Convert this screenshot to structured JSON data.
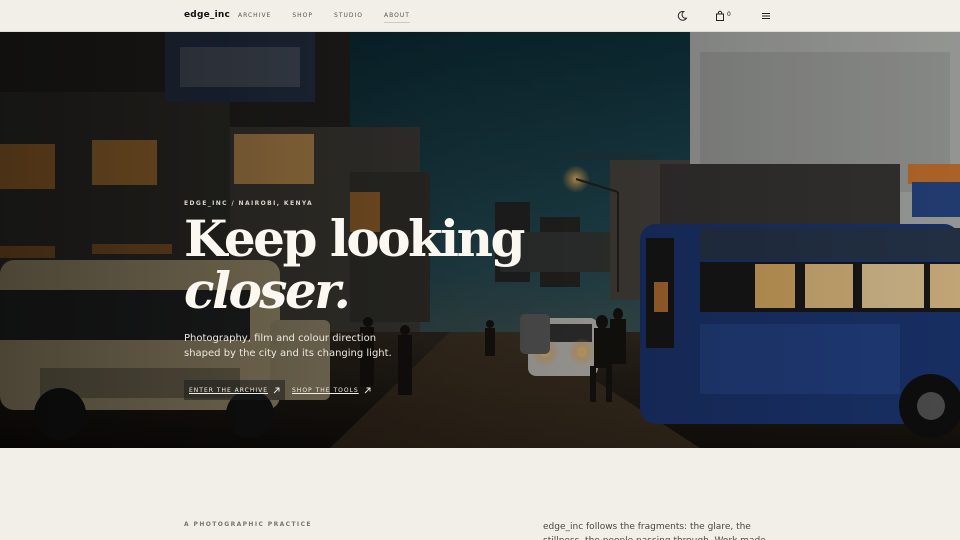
{
  "header": {
    "logo": "edge_inc",
    "nav": [
      "ARCHIVE",
      "SHOP",
      "STUDIO",
      "ABOUT"
    ],
    "cart_count": "0",
    "icons": [
      "moon-icon",
      "cart-icon",
      "menu-icon"
    ]
  },
  "hero": {
    "eyebrow": "EDGE_INC / NAIROBI, KENYA",
    "headline_line1": "Keep looking",
    "headline_line2": "closer.",
    "subtext": "Photography, film and colour direction shaped by the city and its changing light.",
    "cta_primary": "ENTER THE ARCHIVE",
    "cta_secondary": "SHOP THE TOOLS"
  },
  "section": {
    "label": "A PHOTOGRAPHIC PRACTICE",
    "text": "edge_inc follows the fragments: the glare, the stillness, the people passing through. Work made slowly, with room"
  },
  "colors": {
    "background": "#f2efe9",
    "hero_sky": "#1f4a55",
    "bus_blue": "#1e3a7a",
    "street_glow": "#f2a94a"
  }
}
